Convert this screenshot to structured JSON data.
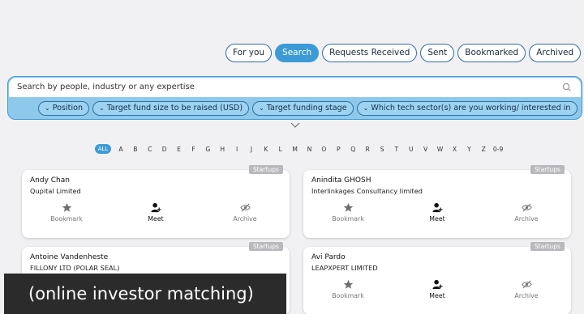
{
  "tabs": [
    "For you",
    "Search",
    "Requests Received",
    "Sent",
    "Bookmarked",
    "Archived"
  ],
  "active_tab": "Search",
  "search": {
    "placeholder": "Search by people, industry or any expertise"
  },
  "filters": [
    "Position",
    "Target fund size to be raised (USD)",
    "Target funding stage",
    "Which tech sector(s) are you working/ interested in"
  ],
  "alphabet": {
    "all_label": "ALL",
    "letters": [
      "A",
      "B",
      "C",
      "D",
      "E",
      "F",
      "G",
      "H",
      "I",
      "J",
      "K",
      "L",
      "M",
      "N",
      "O",
      "P",
      "Q",
      "R",
      "S",
      "T",
      "U",
      "V",
      "W",
      "X",
      "Y",
      "Z",
      "0-9"
    ]
  },
  "cards": [
    {
      "tag": "Startups",
      "name": "Andy Chan",
      "company": "Qupital Limited"
    },
    {
      "tag": "Startups",
      "name": "Anindita GHOSH",
      "company": "Interlinkages Consultancy limited"
    },
    {
      "tag": "Startups",
      "name": "Antoine Vandenheste",
      "company": "FILLONY LTD (POLAR SEAL)"
    },
    {
      "tag": "Startups",
      "name": "Avi Pardo",
      "company": "LEAPXPERT LIMITED"
    }
  ],
  "card_actions": {
    "bookmark": "Bookmark",
    "meet": "Meet",
    "archive": "Archive"
  },
  "caption": "(online investor matching)",
  "colors": {
    "accent": "#3c9bd6",
    "panel": "#8ec9ec",
    "tag": "#b9b9bd"
  }
}
